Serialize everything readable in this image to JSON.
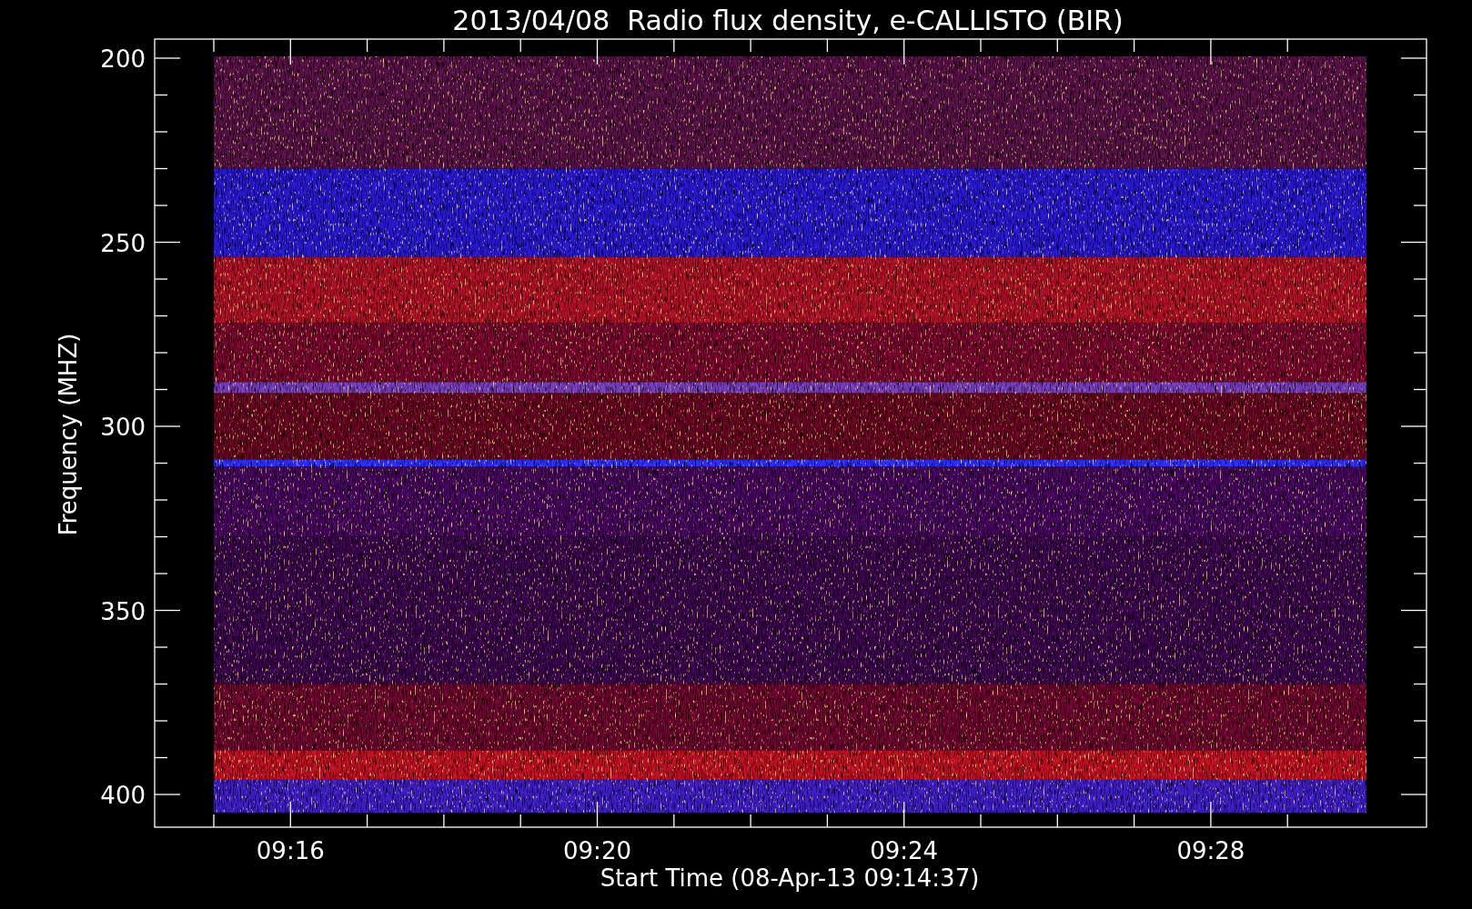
{
  "plot": {
    "title": "2013/04/08  Radio flux density, e-CALLISTO (BIR)",
    "ylabel": "Frequency (MHZ)",
    "xlabel": "Start Time (08-Apr-13 09:14:37)",
    "yticks": [
      "200",
      "250",
      "300",
      "350",
      "400"
    ],
    "xticks": [
      "09:16",
      "09:20",
      "09:24",
      "09:28"
    ]
  }
}
